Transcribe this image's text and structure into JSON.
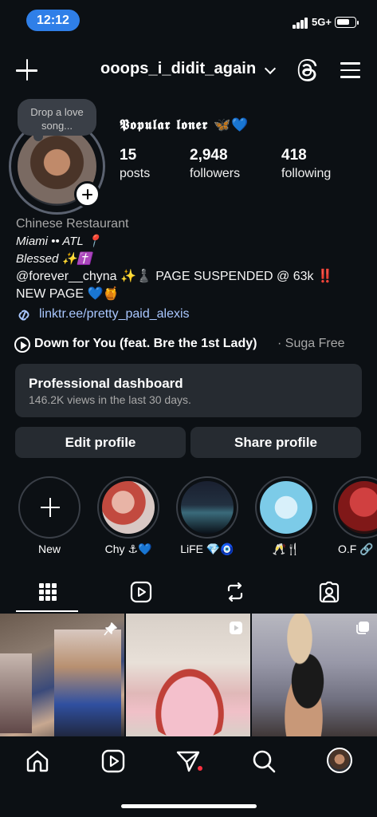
{
  "status_bar": {
    "time": "12:12",
    "network": "5G+",
    "battery_level": 0.75
  },
  "header": {
    "username": "ooops_i_didit_again"
  },
  "profile": {
    "note": "Drop a love song...",
    "display_name": "𝕻𝖔𝖕𝖚𝖑𝖆𝖗 𝖑𝖔𝖓𝖊𝖗 🦋💙",
    "stats": [
      {
        "value": "15",
        "label": "posts"
      },
      {
        "value": "2,948",
        "label": "followers"
      },
      {
        "value": "418",
        "label": "following"
      }
    ],
    "category": "Chinese Restaurant",
    "bio_lines": [
      "Miami •• ATL 📍",
      "Blessed ✨✝️",
      "@forever__chyna ✨♟️ PAGE SUSPENDED @ 63k ‼️",
      "NEW PAGE 💙🍯"
    ],
    "link": "linktr.ee/pretty_paid_alexis",
    "music": {
      "title": "Down for You (feat. Bre the 1st Lady)",
      "artist": "· Suga Free"
    }
  },
  "dashboard": {
    "title": "Professional dashboard",
    "subtitle": "146.2K views in the last 30 days."
  },
  "buttons": {
    "edit": "Edit profile",
    "share": "Share profile"
  },
  "highlights": [
    {
      "label": "New"
    },
    {
      "label": "Chy ⚓💙"
    },
    {
      "label": "LiFE 💎🧿"
    },
    {
      "label": "🥂🍴"
    },
    {
      "label": "O.F 🔗"
    }
  ],
  "icons": {
    "tabs": [
      "grid-icon",
      "reels-icon",
      "reposts-icon",
      "tagged-icon"
    ],
    "nav": [
      "home-icon",
      "reels-icon",
      "direct-icon",
      "search-icon",
      "profile-avatar"
    ]
  },
  "colors": {
    "background": "#0c1014",
    "card": "#262b31",
    "link": "#a9c7ff",
    "time_pill": "#2f7fe8",
    "notification": "#ff3040"
  }
}
